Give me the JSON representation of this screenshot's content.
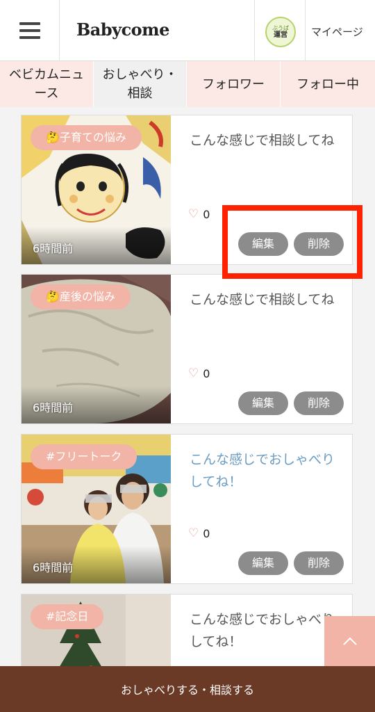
{
  "header": {
    "logo": "Babycome",
    "avatar_top": "ぶうぱ",
    "avatar_bottom": "運営",
    "mypage_label": "マイページ"
  },
  "tabs": [
    {
      "label": "ベビカムニュース",
      "active": false
    },
    {
      "label": "おしゃべり・相談",
      "active": true
    },
    {
      "label": "フォロワー",
      "active": false
    },
    {
      "label": "フォロー中",
      "active": false
    }
  ],
  "posts": [
    {
      "tag": "🤔子育ての悩み",
      "time": "6時間前",
      "title": "こんな感じで相談してね",
      "likes": "0",
      "edit_label": "編集",
      "delete_label": "削除",
      "image": "child-drawing"
    },
    {
      "tag": "🤔産後の悩み",
      "time": "6時間前",
      "title": "こんな感じで相談してね",
      "likes": "0",
      "edit_label": "編集",
      "delete_label": "削除",
      "image": "baby-clothes"
    },
    {
      "tag": "#フリートーク",
      "time": "6時間前",
      "title": "こんな感じでおしゃべりしてね！",
      "likes": "0",
      "edit_label": "編集",
      "delete_label": "削除",
      "image": "mother-daughter"
    },
    {
      "tag": "#記念日",
      "title": "こんな感じでおしゃべりしてね！",
      "image": "christmas-tree"
    }
  ],
  "bottom_bar": {
    "label": "おしゃべりする・相談する"
  },
  "colors": {
    "accent_pink": "#f2b4a6",
    "tab_bg": "#fce9e6",
    "bottom_bar": "#6a3a26",
    "highlight": "#ff2200",
    "link_blue": "#6a9cc3"
  }
}
